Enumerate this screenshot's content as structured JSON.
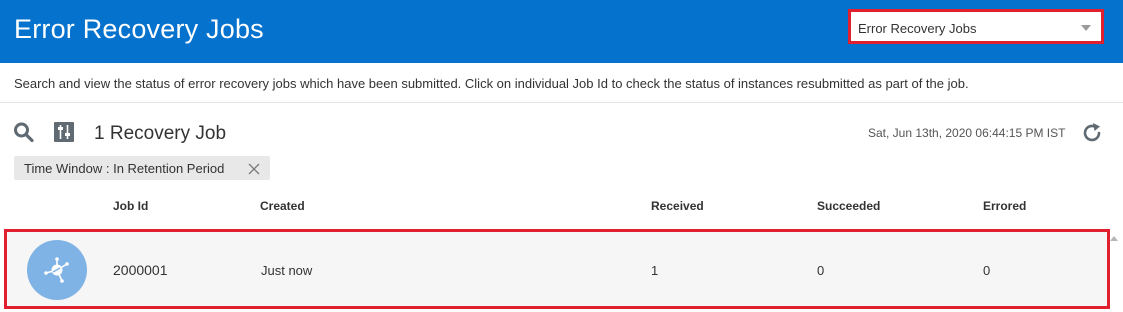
{
  "header": {
    "title": "Error Recovery Jobs",
    "page_selector": "Error Recovery Jobs"
  },
  "description": "Search and view the status of error recovery jobs which have been submitted. Click on individual Job Id to check the status of instances resubmitted as part of the job.",
  "toolbar": {
    "job_count": "1 Recovery Job",
    "timestamp": "Sat, Jun 13th, 2020 06:44:15 PM IST",
    "icons": [
      "search-icon",
      "filter-icon",
      "refresh-icon"
    ]
  },
  "filter_chip": {
    "label": "Time Window : In Retention Period"
  },
  "table": {
    "columns": [
      "Job Id",
      "Created",
      "Received",
      "Succeeded",
      "Errored"
    ],
    "rows": [
      {
        "job_id": "2000001",
        "created": "Just now",
        "received": "1",
        "succeeded": "0",
        "errored": "0"
      }
    ]
  },
  "colors": {
    "header_bg": "#0572ce",
    "highlight_border": "#e0202e",
    "avatar_bg": "#7fb2e5"
  }
}
